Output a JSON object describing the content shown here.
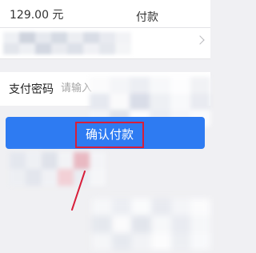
{
  "amount": {
    "text": "129.00 元"
  },
  "payment_method": {
    "text_fragment": "付款"
  },
  "password": {
    "label": "支付密码",
    "placeholder": "请输入"
  },
  "confirm": {
    "label": "确认付款"
  },
  "colors": {
    "primary": "#2e7bf2",
    "highlight": "#d81e3a",
    "background": "#f0f0f3"
  },
  "icons": {
    "chevron": "chevron-right-icon"
  }
}
